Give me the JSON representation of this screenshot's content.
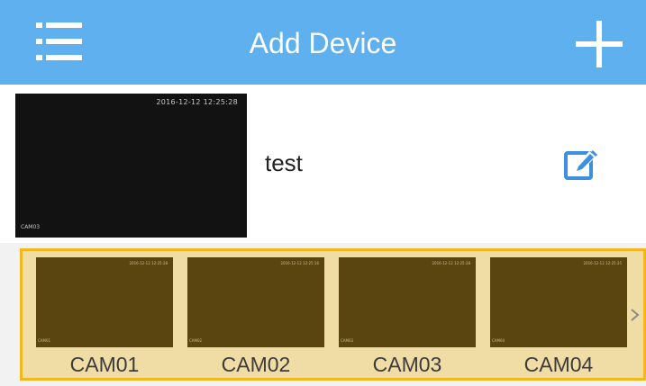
{
  "header": {
    "title": "Add Device",
    "menu_icon": "list-menu-icon",
    "add_icon": "plus-icon"
  },
  "device": {
    "name": "test",
    "preview_timestamp": "2016-12-12 12:25:28",
    "preview_camera": "CAM03",
    "edit_icon": "edit-icon"
  },
  "channels": [
    {
      "label": "CAM01",
      "preview_timestamp": "2016-12-12 12:25:38",
      "preview_camera": "CAM01"
    },
    {
      "label": "CAM02",
      "preview_timestamp": "2016-12-12 12:25:16",
      "preview_camera": "CAM02"
    },
    {
      "label": "CAM03",
      "preview_timestamp": "2016-12-12 12:25:38",
      "preview_camera": "CAM03"
    },
    {
      "label": "CAM04",
      "preview_timestamp": "2016-12-12 12:25:35",
      "preview_camera": "CAM04"
    }
  ],
  "colors": {
    "header_bg": "#5eb0ef",
    "edit_icon": "#3d8fe0",
    "strip_bg": "#f0dda5",
    "strip_border": "#f5b81c",
    "thumb_bg": "#5a4410"
  }
}
